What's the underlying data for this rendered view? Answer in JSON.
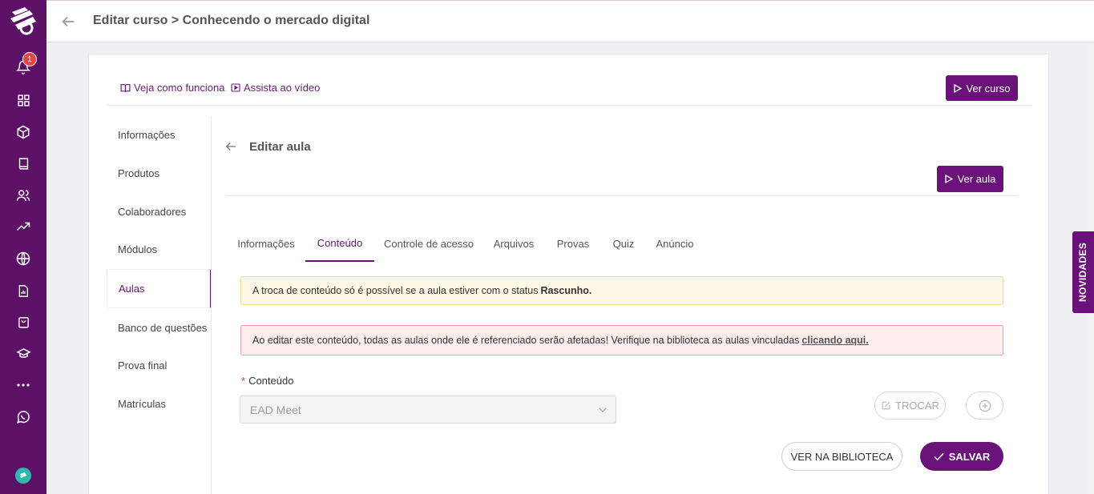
{
  "header": {
    "title": "Editar curso > Conhecendo o mercado digital"
  },
  "sidebar": {
    "notification_count": "1",
    "icons": [
      "logo-icon",
      "bell-icon",
      "grid-icon",
      "box-icon",
      "book-icon",
      "users-icon",
      "trending-up-icon",
      "globe-icon",
      "report-icon",
      "bag-icon",
      "graduation-cap-icon",
      "more-icon",
      "whatsapp-icon",
      "avatar"
    ]
  },
  "help": {
    "how_it_works": "Veja como funciona",
    "watch_video": "Assista ao vídeo"
  },
  "course": {
    "view_course": "Ver curso"
  },
  "nav": {
    "items": [
      {
        "label": "Informações"
      },
      {
        "label": "Produtos"
      },
      {
        "label": "Colaboradores"
      },
      {
        "label": "Módulos"
      },
      {
        "label": "Aulas"
      },
      {
        "label": "Banco de questões"
      },
      {
        "label": "Prova final"
      },
      {
        "label": "Matrículas"
      }
    ],
    "active": "Aulas"
  },
  "lesson": {
    "title": "Editar aula",
    "view_lesson": "Ver aula"
  },
  "tabs": [
    {
      "label": "Informações"
    },
    {
      "label": "Conteúdo"
    },
    {
      "label": "Controle de acesso"
    },
    {
      "label": "Arquivos"
    },
    {
      "label": "Provas"
    },
    {
      "label": "Quiz"
    },
    {
      "label": "Anúncio"
    }
  ],
  "active_tab": "Conteúdo",
  "alerts": {
    "warning_text": "A troca de conteúdo só é possível se a aula estiver com o status",
    "warning_bold": "Rascunho.",
    "danger_text": "Ao editar este conteúdo, todas as aulas onde ele é referenciado serão afetadas! Verifique na biblioteca as aulas vinculadas",
    "danger_link": "clicando aqui."
  },
  "content_field": {
    "label": "Conteúdo",
    "value": "EAD Meet"
  },
  "actions": {
    "swap": "TROCAR",
    "view_library": "VER NA BIBLIOTECA",
    "save": "SALVAR"
  },
  "side_tab": {
    "label": "NOVIDADES"
  },
  "colors": {
    "brand": "#6a1279",
    "sidebar": "#5c1166",
    "badge": "#e84545"
  }
}
